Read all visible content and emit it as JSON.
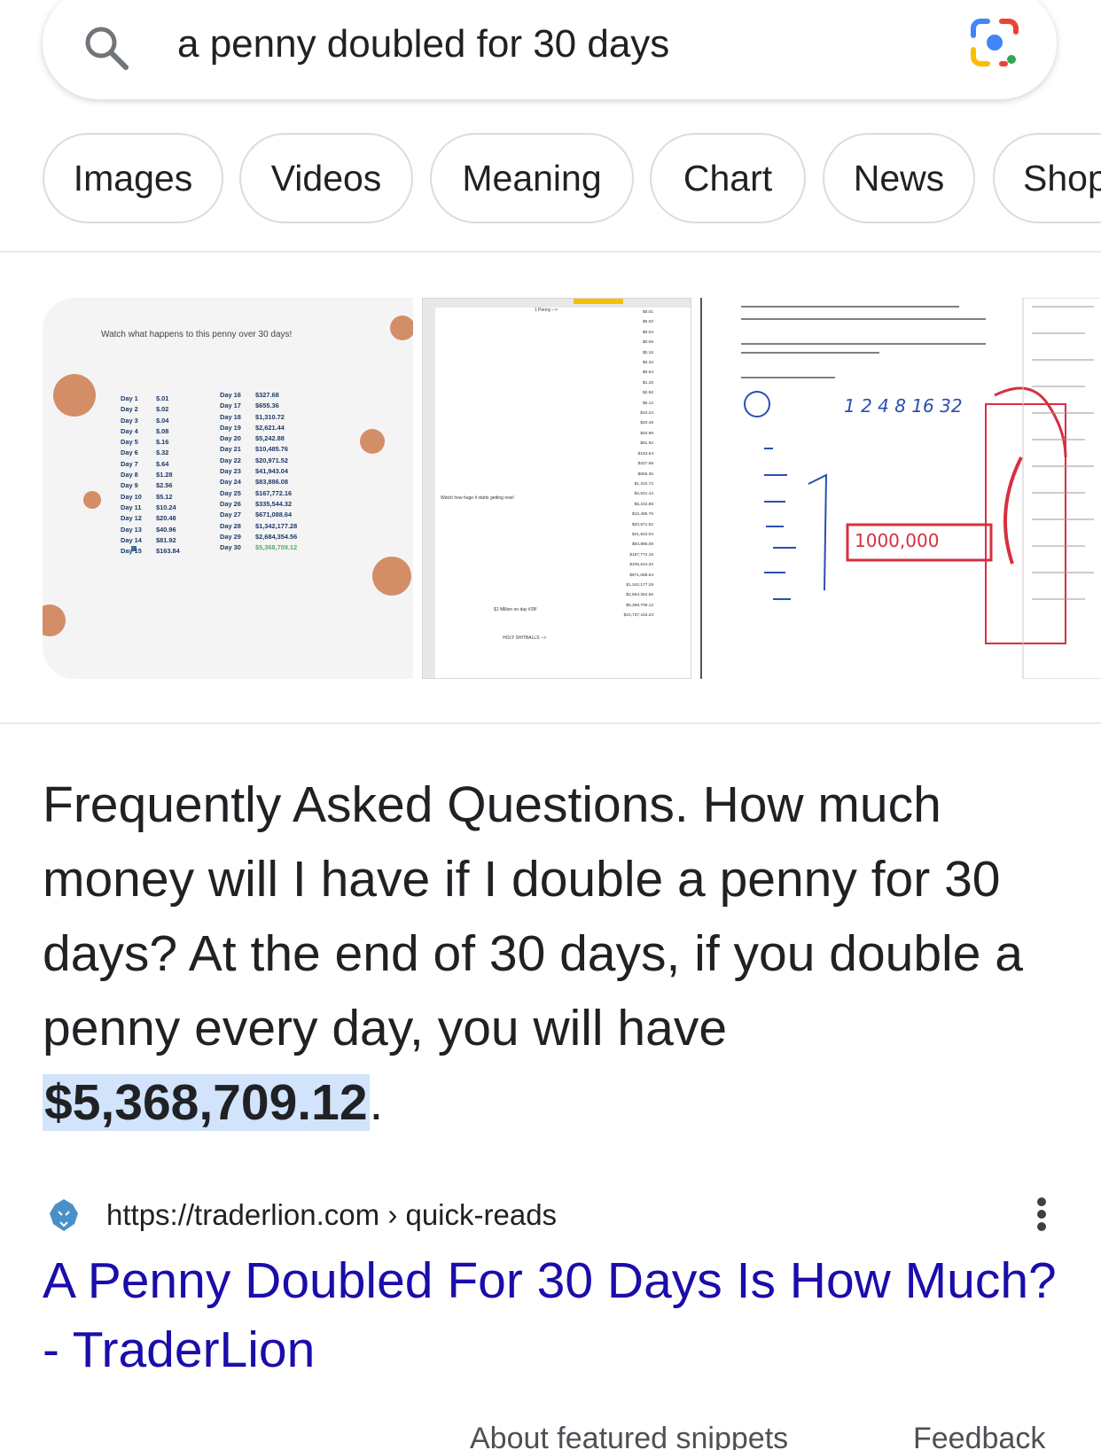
{
  "search": {
    "query": "a penny doubled for 30 days"
  },
  "chips": [
    "Images",
    "Videos",
    "Meaning",
    "Chart",
    "News",
    "Shopping"
  ],
  "thumbnails": {
    "t1": {
      "title": "Watch what happens to this penny over 30 days!",
      "col1": [
        {
          "day": "Day 1",
          "val": "$.01"
        },
        {
          "day": "Day 2",
          "val": "$.02"
        },
        {
          "day": "Day 3",
          "val": "$.04"
        },
        {
          "day": "Day 4",
          "val": "$.08"
        },
        {
          "day": "Day 5",
          "val": "$.16"
        },
        {
          "day": "Day 6",
          "val": "$.32"
        },
        {
          "day": "Day 7",
          "val": "$.64"
        },
        {
          "day": "Day 8",
          "val": "$1.28"
        },
        {
          "day": "Day 9",
          "val": "$2.56"
        },
        {
          "day": "Day 10",
          "val": "$5.12"
        },
        {
          "day": "Day 11",
          "val": "$10.24"
        },
        {
          "day": "Day 12",
          "val": "$20.48"
        },
        {
          "day": "Day 13",
          "val": "$40.96"
        },
        {
          "day": "Day 14",
          "val": "$81.92"
        },
        {
          "day": "Day 15",
          "val": "$163.84"
        }
      ],
      "col2": [
        {
          "day": "Day 16",
          "val": "$327.68"
        },
        {
          "day": "Day 17",
          "val": "$655.36"
        },
        {
          "day": "Day 18",
          "val": "$1,310.72"
        },
        {
          "day": "Day 19",
          "val": "$2,621.44"
        },
        {
          "day": "Day 20",
          "val": "$5,242.88"
        },
        {
          "day": "Day 21",
          "val": "$10,485.76"
        },
        {
          "day": "Day 22",
          "val": "$20,971.52"
        },
        {
          "day": "Day 23",
          "val": "$41,943.04"
        },
        {
          "day": "Day 24",
          "val": "$83,886.08"
        },
        {
          "day": "Day 25",
          "val": "$167,772.16"
        },
        {
          "day": "Day 26",
          "val": "$335,544.32"
        },
        {
          "day": "Day 27",
          "val": "$671,088.64"
        },
        {
          "day": "Day 28",
          "val": "$1,342,177.28"
        },
        {
          "day": "Day 29",
          "val": "$2,684,354.56"
        },
        {
          "day": "Day 30",
          "val": "$5,368,709.12"
        }
      ]
    },
    "t2": {
      "penny_label": "1 Penny -->",
      "watch_label": "Watch how huge it starts getting now!",
      "million_label": "$1 Million on day #28!",
      "holy_label": "HOLY SHITBALLS -->",
      "values": [
        "$0.01",
        "$0.02",
        "$0.04",
        "$0.08",
        "$0.16",
        "$0.32",
        "$0.64",
        "$1.28",
        "$2.56",
        "$5.12",
        "$10.24",
        "$20.48",
        "$40.96",
        "$81.92",
        "$163.84",
        "$327.68",
        "$655.36",
        "$1,310.72",
        "$2,621.44",
        "$5,242.88",
        "$10,485.76",
        "$20,971.52",
        "$41,943.04",
        "$83,886.08",
        "$167,772.16",
        "$335,544.32",
        "$671,088.64",
        "$1,342,177.28",
        "$2,684,354.56",
        "$5,368,709.12",
        "$10,737,418.23"
      ]
    },
    "t3": {
      "notes": [
        "1 2 4 8 16 32",
        "1000,000"
      ]
    }
  },
  "answer": {
    "text": "Frequently Asked Questions. How much money will I have if I double a penny for 30 days? At the end of 30 days, if you double a penny every day, you will have ",
    "highlight": "$5,368,709.12",
    "end": "."
  },
  "source": {
    "url": "https://traderlion.com",
    "path": "› quick-reads",
    "title": "A Penny Doubled For 30 Days Is How Much? - TraderLion"
  },
  "footer": {
    "about": "About featured snippets",
    "feedback": "Feedback"
  },
  "colors": {
    "link": "#1a0dab",
    "highlight": "#d2e3fc",
    "chip_border": "#dadce0"
  }
}
